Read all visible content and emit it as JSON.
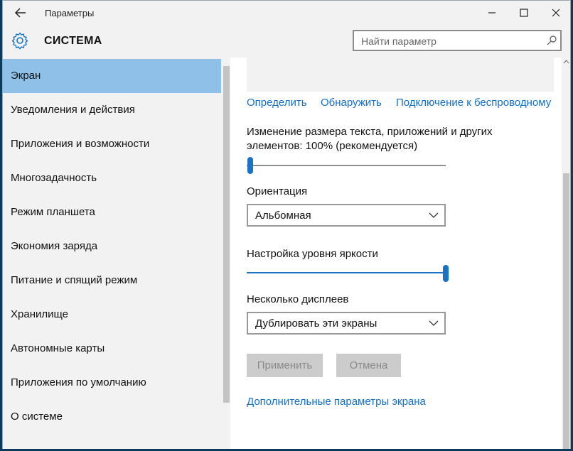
{
  "window": {
    "title": "Параметры"
  },
  "header": {
    "heading": "СИСТЕМА",
    "search_placeholder": "Найти параметр"
  },
  "sidebar": {
    "items": [
      {
        "label": "Экран",
        "active": true
      },
      {
        "label": "Уведомления и действия"
      },
      {
        "label": "Приложения и возможности"
      },
      {
        "label": "Многозадачность"
      },
      {
        "label": "Режим планшета"
      },
      {
        "label": "Экономия заряда"
      },
      {
        "label": "Питание и спящий режим"
      },
      {
        "label": "Хранилище"
      },
      {
        "label": "Автономные карты"
      },
      {
        "label": "Приложения по умолчанию"
      },
      {
        "label": "О системе"
      }
    ]
  },
  "main": {
    "links": {
      "identify": "Определить",
      "detect": "Обнаружить",
      "wireless": "Подключение к беспроводному"
    },
    "scale": {
      "label_line1": "Изменение размера текста, приложений и других",
      "label_line2": "элементов: 100% (рекомендуется)",
      "value_fraction": 0.0
    },
    "orientation": {
      "label": "Ориентация",
      "value": "Альбомная"
    },
    "brightness": {
      "label": "Настройка уровня яркости",
      "value_fraction": 1.0
    },
    "multiple_displays": {
      "label": "Несколько дисплеев",
      "value": "Дублировать эти экраны"
    },
    "buttons": {
      "apply": "Применить",
      "cancel": "Отмена"
    },
    "advanced_link": "Дополнительные параметры экрана"
  },
  "colors": {
    "accent": "#1a73c2",
    "selected_nav": "#8fc0e8",
    "link": "#1670c4"
  }
}
